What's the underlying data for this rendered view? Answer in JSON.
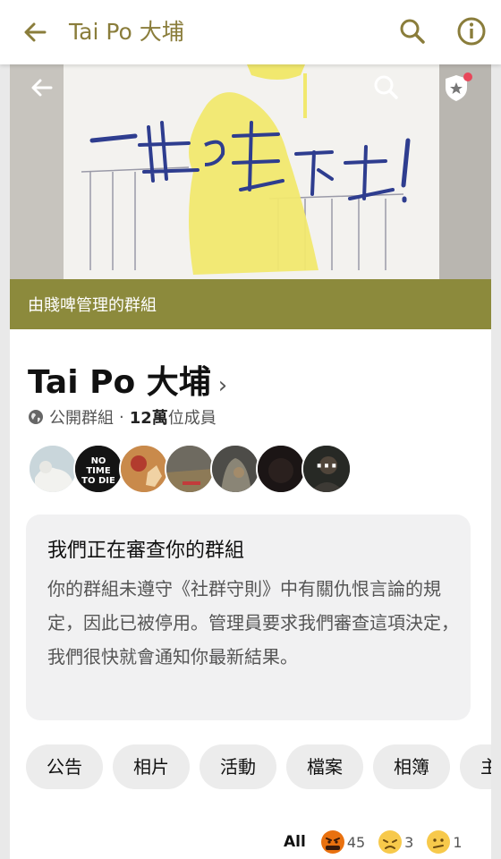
{
  "appbar": {
    "title": "Tai Po 大埔",
    "back_icon": "arrow-left-icon",
    "search_icon": "search-icon",
    "info_icon": "info-icon",
    "accent": "#8a7d3b"
  },
  "cover": {
    "photo_text": "一起走下去!",
    "back_icon": "arrow-left-icon",
    "search_icon": "search-icon",
    "admin_icon": "shield-star-icon"
  },
  "banner": {
    "label": "由賤啤管理的群組",
    "color": "#8c8a3c"
  },
  "group": {
    "name": "Tai Po 大埔",
    "chevron": "›",
    "privacy": "公開群組",
    "separator": "·",
    "member_count": "12萬",
    "member_suffix": "位成員"
  },
  "members": {
    "avatars": [
      {
        "name": "member-avatar-1"
      },
      {
        "name": "member-avatar-2",
        "caption": "NO TIME TO DIE"
      },
      {
        "name": "member-avatar-3"
      },
      {
        "name": "member-avatar-4"
      },
      {
        "name": "member-avatar-5"
      },
      {
        "name": "member-avatar-6"
      },
      {
        "name": "member-avatar-7"
      }
    ],
    "more_label": "···"
  },
  "notice": {
    "title": "我們正在審查你的群組",
    "body": "你的群組未遵守《社群守則》中有關仇恨言論的規定，因此已被停用。管理員要求我們審查這項決定，我們很快就會通知你最新結果。"
  },
  "tabs": [
    "公告",
    "相片",
    "活動",
    "檔案",
    "相簿",
    "主題"
  ],
  "reactions": {
    "all_label": "All",
    "items": [
      {
        "icon": "angry-emoji-icon",
        "count": "45",
        "color": "#e9710f"
      },
      {
        "icon": "sad-emoji-icon",
        "count": "3",
        "color": "#f7c94b"
      },
      {
        "icon": "confused-emoji-icon",
        "count": "1",
        "color": "#f7c94b"
      }
    ]
  }
}
